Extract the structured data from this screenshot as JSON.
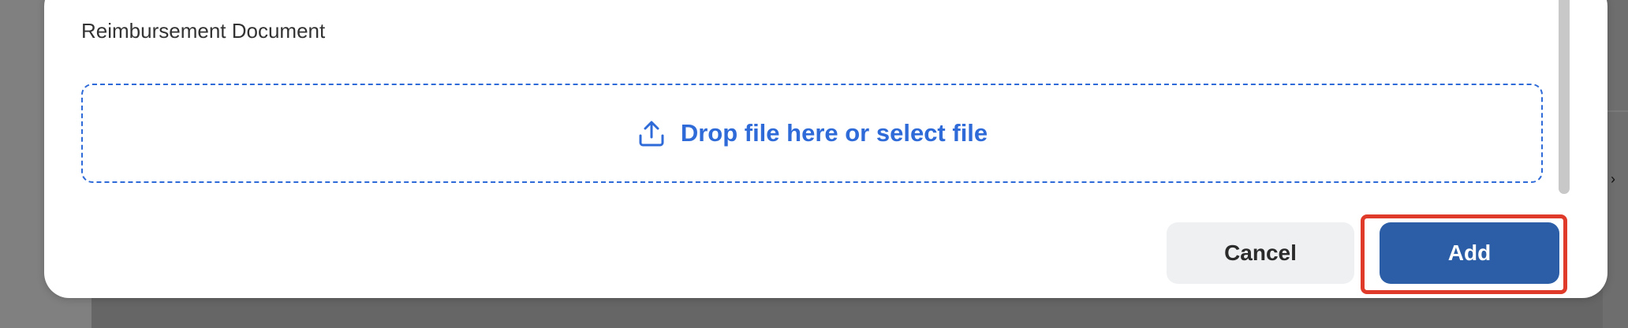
{
  "modal": {
    "field_label": "Reimbursement Document",
    "dropzone": {
      "text": "Drop file here or select file",
      "icon": "upload-icon"
    },
    "buttons": {
      "cancel_label": "Cancel",
      "add_label": "Add"
    }
  },
  "colors": {
    "accent": "#2f6bd8",
    "primary_button": "#2b5ea6",
    "secondary_button": "#eef0f2",
    "highlight": "#e03a2b"
  }
}
